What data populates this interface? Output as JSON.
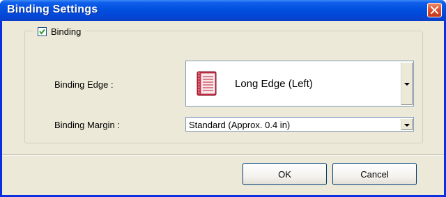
{
  "window": {
    "title": "Binding Settings"
  },
  "group": {
    "label": "Binding",
    "checked": true
  },
  "binding_edge": {
    "label": "Binding Edge :",
    "value": "Long Edge (Left)",
    "icon": "book-icon"
  },
  "binding_margin": {
    "label": "Binding Margin :",
    "value": "Standard (Approx. 0.4 in)"
  },
  "buttons": {
    "ok": "OK",
    "cancel": "Cancel"
  },
  "colors": {
    "titlebar": "#0352e0",
    "dialog_bg": "#ece9d8",
    "close": "#e0502c",
    "book": "#d0304a"
  }
}
